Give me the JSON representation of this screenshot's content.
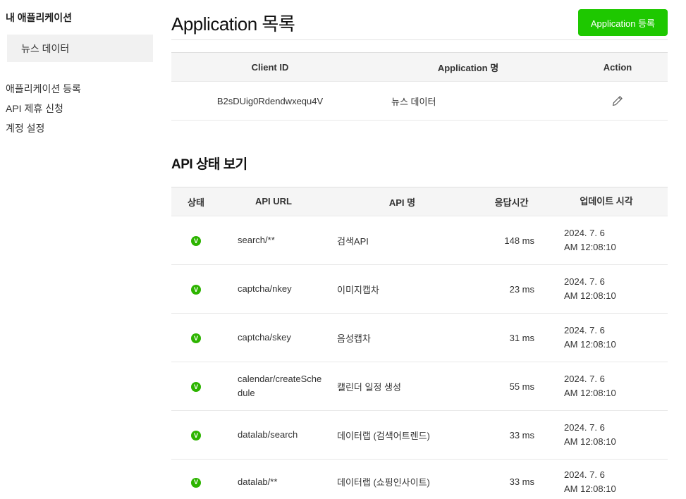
{
  "colors": {
    "accent-green": "#1ec800",
    "status-green": "#2db400"
  },
  "icons": {
    "status_ok_letter": "V",
    "edit_icon_name": "pencil-icon"
  },
  "sidebar": {
    "title": "내 애플리케이션",
    "selected_app": "뉴스 데이터",
    "items": [
      {
        "label": "애플리케이션 등록"
      },
      {
        "label": "API 제휴 신청"
      },
      {
        "label": "계정 설정"
      }
    ]
  },
  "main": {
    "title": "Application 목록",
    "register_button_label": "Application 등록",
    "app_table": {
      "headers": [
        "Client ID",
        "Application 명",
        "Action"
      ],
      "rows": [
        {
          "client_id": "B2sDUig0Rdendwxequ4V",
          "app_name": "뉴스 데이터"
        }
      ]
    },
    "api_status": {
      "title": "API 상태 보기",
      "headers": [
        "상태",
        "API URL",
        "API 명",
        "응답시간",
        "업데이트 시각"
      ],
      "rows": [
        {
          "status": "ok",
          "api_url": "search/**",
          "api_name": "검색API",
          "response_time": "148 ms",
          "updated_date": "2024. 7. 6",
          "updated_time": "AM 12:08:10"
        },
        {
          "status": "ok",
          "api_url": "captcha/nkey",
          "api_name": "이미지캡차",
          "response_time": "23 ms",
          "updated_date": "2024. 7. 6",
          "updated_time": "AM 12:08:10"
        },
        {
          "status": "ok",
          "api_url": "captcha/skey",
          "api_name": "음성캡차",
          "response_time": "31 ms",
          "updated_date": "2024. 7. 6",
          "updated_time": "AM 12:08:10"
        },
        {
          "status": "ok",
          "api_url": "calendar/createSchedule",
          "api_name": "캘린더 일정 생성",
          "response_time": "55 ms",
          "updated_date": "2024. 7. 6",
          "updated_time": "AM 12:08:10"
        },
        {
          "status": "ok",
          "api_url": "datalab/search",
          "api_name": "데이터랩 (검색어트렌드)",
          "response_time": "33 ms",
          "updated_date": "2024. 7. 6",
          "updated_time": "AM 12:08:10"
        },
        {
          "status": "ok",
          "api_url": "datalab/**",
          "api_name": "데이터랩 (쇼핑인사이트)",
          "response_time": "33 ms",
          "updated_date": "2024. 7. 6",
          "updated_time": "AM 12:08:10"
        }
      ]
    }
  }
}
